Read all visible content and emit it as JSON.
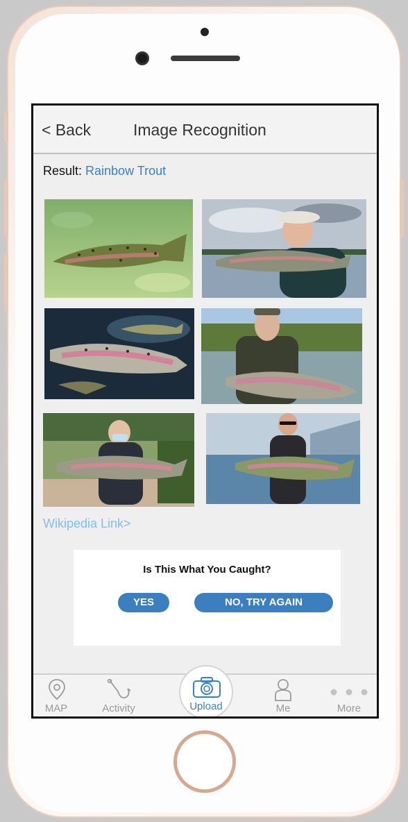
{
  "header": {
    "back_label": "< Back",
    "title": "Image Recognition"
  },
  "result": {
    "prefix": "Result: ",
    "species": "Rainbow Trout"
  },
  "wiki_link": "Wikipedia Link>",
  "dialog": {
    "question": "Is This What You Caught?",
    "yes_label": "YES",
    "no_label": "NO, TRY AGAIN"
  },
  "tabs": [
    {
      "label": "MAP",
      "icon": "map-pin-icon"
    },
    {
      "label": "Activity",
      "icon": "fishing-hook-icon"
    },
    {
      "label": "Upload",
      "icon": "camera-icon"
    },
    {
      "label": "Me",
      "icon": "person-icon"
    },
    {
      "label": "More",
      "icon": "more-dots-icon"
    }
  ],
  "colors": {
    "accent": "#3b7fc1",
    "link": "#3a82c4",
    "wiki_link": "#7fbfea"
  }
}
